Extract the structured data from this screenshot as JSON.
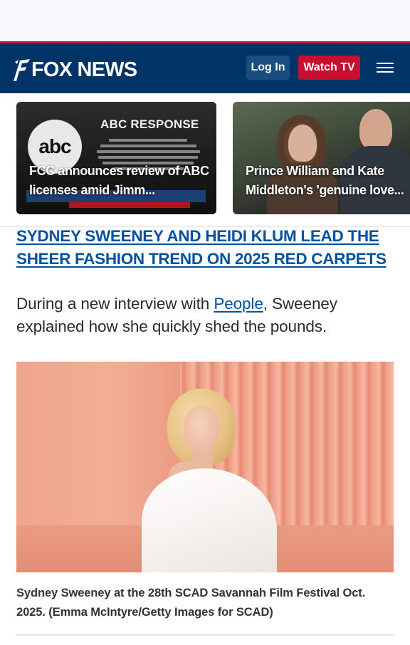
{
  "colors": {
    "header_bg": "#003366",
    "brand_red": "#c8102e",
    "login_bg": "#1a4d80",
    "link_blue": "#00519e"
  },
  "header": {
    "logo_text": "FOX NEWS",
    "login_label": "Log In",
    "watch_label": "Watch TV",
    "menu_icon": "hamburger-menu-icon"
  },
  "carousel": [
    {
      "caption": "FCC announces review of ABC licenses amid Jimm...",
      "image_text": "ABC RESPONSE",
      "image_logo": "abc"
    },
    {
      "caption": "Prince William and Kate Middleton's 'genuine love..."
    }
  ],
  "article": {
    "related_headline": "SYDNEY SWEENEY AND HEIDI KLUM LEAD THE SHEER FASHION TREND ON 2025 RED CARPETS",
    "paragraph_before": "During a new interview with ",
    "paragraph_link": "People",
    "paragraph_after": ", Sweeney explained how she quickly shed the pounds.",
    "photo_caption": "Sydney Sweeney at the 28th SCAD Savannah Film Festival Oct. 2025. (Emma McIntyre/Getty Images for SCAD)"
  }
}
